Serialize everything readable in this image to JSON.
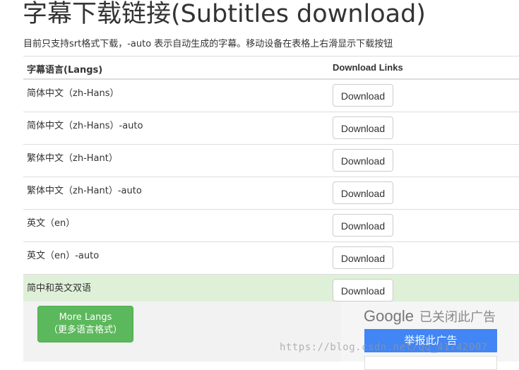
{
  "page": {
    "title": "字幕下载链接(Subtitles download)",
    "description": "目前只支持srt格式下载，-auto 表示自动生成的字幕。移动设备在表格上右滑显示下载按钮"
  },
  "table": {
    "headers": [
      "字幕语言(Langs)",
      "Download Links"
    ],
    "rows": [
      {
        "lang": "简体中文（zh-Hans）",
        "button": "Download"
      },
      {
        "lang": "简体中文（zh-Hans）-auto",
        "button": "Download"
      },
      {
        "lang": "繁体中文（zh-Hant）",
        "button": "Download"
      },
      {
        "lang": "繁体中文（zh-Hant）-auto",
        "button": "Download"
      },
      {
        "lang": "英文（en）",
        "button": "Download"
      },
      {
        "lang": "英文（en）-auto",
        "button": "Download"
      },
      {
        "lang": "简中和英文双语",
        "button": "Download",
        "highlighted": true
      }
    ]
  },
  "more_langs": {
    "line1": "More Langs",
    "line2": "（更多语言格式）"
  },
  "ad": {
    "logo": "Google",
    "closed_text": "已关闭此广告",
    "report_button": "举报此广告"
  },
  "watermark": "https://blog.csdn.net/qq_41742007",
  "colors": {
    "highlight_row": "#dff0d8",
    "more_button": "#5cb85c",
    "report_button": "#4285f4"
  }
}
